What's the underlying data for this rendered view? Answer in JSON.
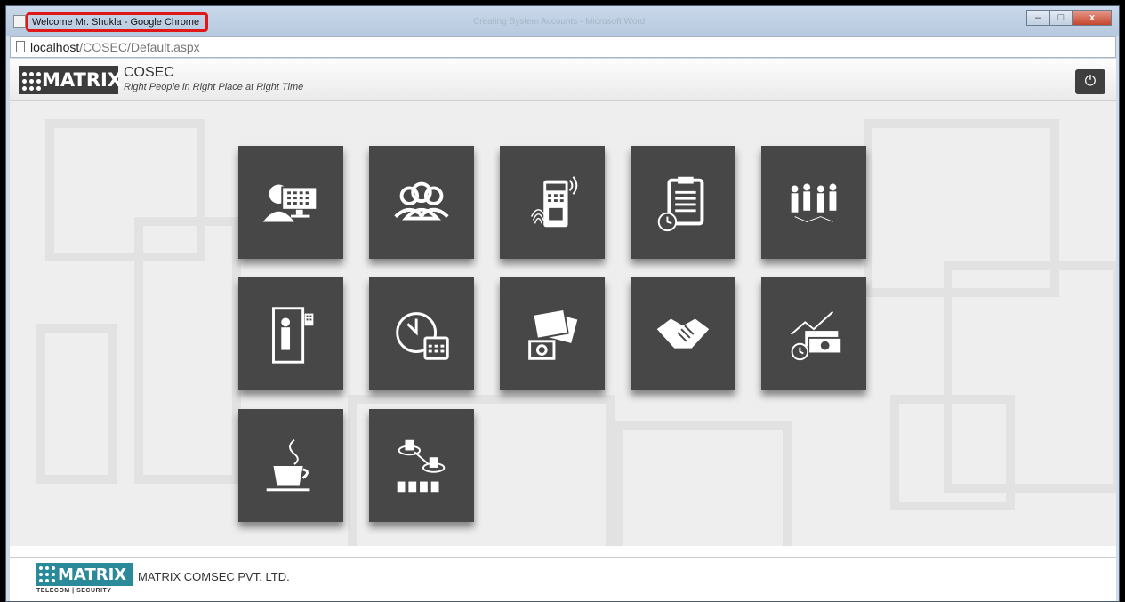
{
  "window": {
    "title": "Welcome Mr. Shukla - Google Chrome",
    "background_title": "Creating System Accounts - Microsoft Word",
    "minimize": "–",
    "maximize": "□",
    "close": "x"
  },
  "address": {
    "host": "localhost",
    "path": "/COSEC/Default.aspx"
  },
  "header": {
    "logo_text": "MATRIX",
    "app_name": "COSEC",
    "tagline": "Right People in Right Place at Right Time",
    "power_icon": "power-icon"
  },
  "modules": [
    {
      "icon": "operator-monitor-icon"
    },
    {
      "icon": "users-group-icon"
    },
    {
      "icon": "biometric-device-icon"
    },
    {
      "icon": "clipboard-clock-icon"
    },
    {
      "icon": "people-network-icon"
    },
    {
      "icon": "door-access-icon"
    },
    {
      "icon": "clock-calendar-icon"
    },
    {
      "icon": "photo-camera-icon"
    },
    {
      "icon": "handshake-icon"
    },
    {
      "icon": "payroll-money-icon"
    },
    {
      "icon": "coffee-cup-icon"
    },
    {
      "icon": "hierarchy-icon"
    }
  ],
  "footer": {
    "logo_text": "MATRIX",
    "logo_sub": "TELECOM | SECURITY",
    "company": "MATRIX COMSEC PVT. LTD."
  },
  "colors": {
    "tile_bg": "#474747",
    "highlight_border": "#e01818",
    "footer_logo": "#2b8a9a"
  }
}
